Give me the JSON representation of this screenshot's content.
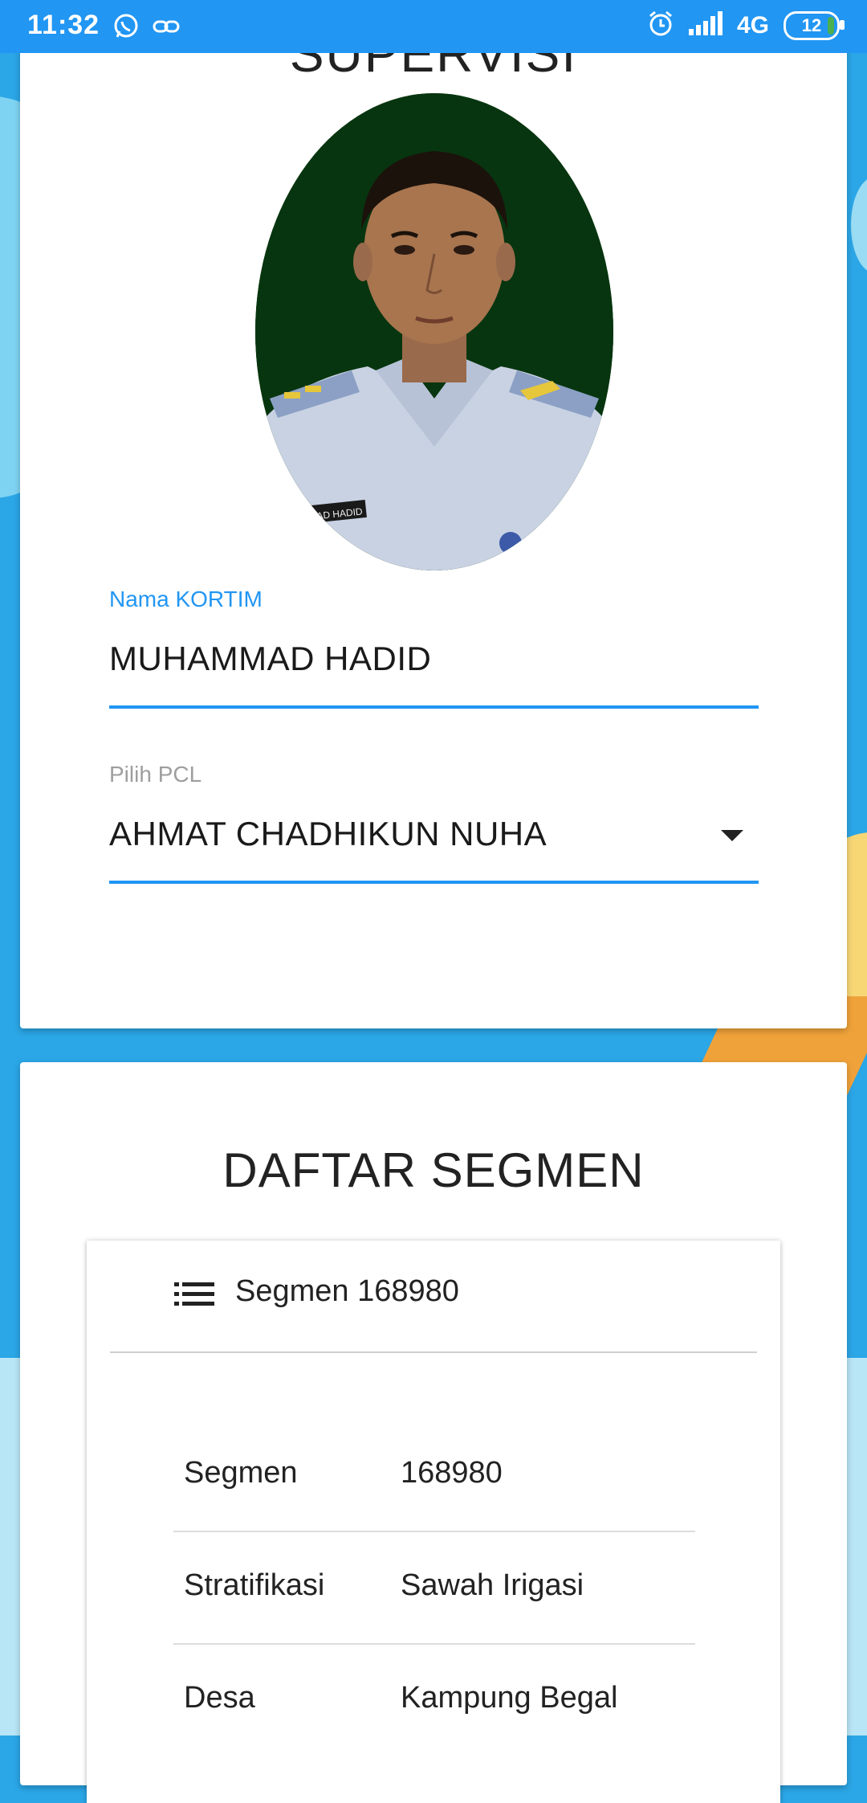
{
  "status_bar": {
    "time": "11:32",
    "network": "4G",
    "battery": "12",
    "icons": [
      "whatsapp-icon",
      "link-icon",
      "alarm-icon",
      "signal-icon",
      "battery-icon"
    ]
  },
  "profile_card": {
    "title": "SUPERVISI",
    "kortim_label": "Nama KORTIM",
    "kortim_value": "MUHAMMAD HADID",
    "pcl_label": "Pilih PCL",
    "pcl_value": "AHMAT CHADHIKUN NUHA",
    "photo_badge": "MAD HADID"
  },
  "segment_list": {
    "title": "DAFTAR SEGMEN",
    "item_header": "Segmen 168980",
    "rows": [
      {
        "label": "Segmen",
        "value": "168980"
      },
      {
        "label": "Stratifikasi",
        "value": "Sawah Irigasi"
      },
      {
        "label": "Desa",
        "value": "Kampung Begal"
      }
    ]
  },
  "colors": {
    "accent": "#2196f3",
    "status_bar": "#2196f3",
    "label_active": "#2196f3",
    "label_inactive": "#9e9e9e"
  }
}
